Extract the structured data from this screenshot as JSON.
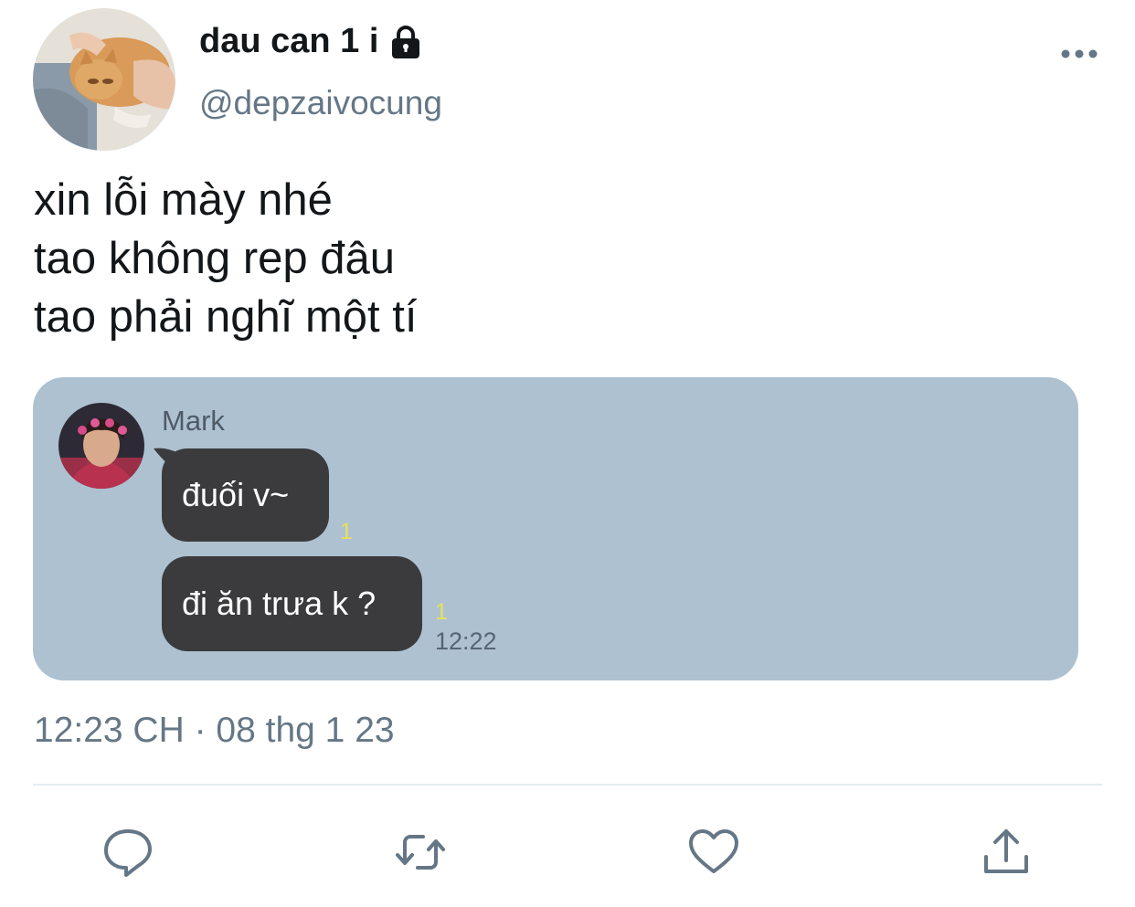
{
  "tweet": {
    "display_name": "dau can 1 i",
    "handle": "@depzaivocung",
    "text_lines": [
      "xin lỗi mày nhé",
      "tao không rep đâu",
      "tao phải nghĩ một tí"
    ],
    "timestamp": "12:23 CH · 08 thg 1 23"
  },
  "icons": {
    "lock": "lock-icon",
    "more": "more-horizontal-icon",
    "reply": "reply-bubble-icon",
    "retweet": "retweet-icon",
    "like": "heart-icon",
    "share": "share-icon"
  },
  "chat_screenshot": {
    "sender": "Mark",
    "messages": [
      {
        "text": "đuối v~",
        "read_count": "1"
      },
      {
        "text": "đi ăn trưa k ?",
        "read_count": "1",
        "time": "12:22"
      }
    ]
  },
  "colors": {
    "text_primary": "#14171a",
    "text_secondary": "#657786",
    "chat_background": "#aec1d1",
    "bubble": "#3b3b3d",
    "read_count": "#e9e05b"
  }
}
